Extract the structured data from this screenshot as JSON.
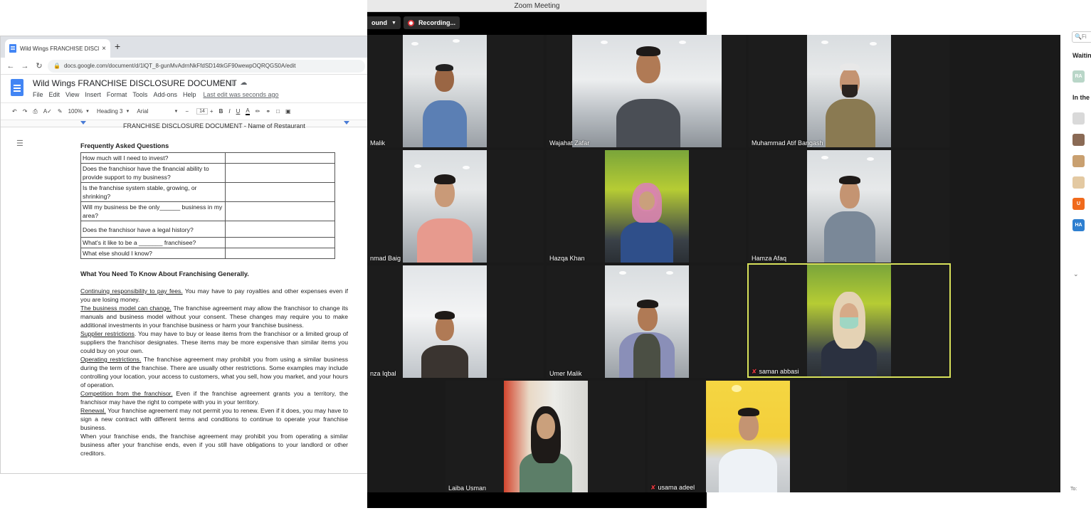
{
  "browser": {
    "tab_title": "Wild Wings FRANCHISE DISCLOSU",
    "tab_close": "×",
    "new_tab": "+",
    "url": "docs.google.com/document/d/1lQT_8-gunMvAdrnNkFfdSD14tkGF90wewpOQRQGS0A/edit"
  },
  "docs": {
    "title": "Wild Wings FRANCHISE DISCLOSURE DOCUMENT",
    "menu": [
      "File",
      "Edit",
      "View",
      "Insert",
      "Format",
      "Tools",
      "Add-ons",
      "Help"
    ],
    "last_edit": "Last edit was seconds ago",
    "toolbar": {
      "zoom": "100%",
      "style": "Heading 3",
      "font": "Arial",
      "font_minus": "−",
      "font_size": "14",
      "font_plus": "+",
      "bold": "B",
      "italic": "I",
      "underline": "U",
      "text_color": "A"
    },
    "page_header": "FRANCHISE DISCLOSURE DOCUMENT - Name of Restaurant",
    "faq_heading": "Frequently Asked Questions",
    "faq_rows": [
      "How much will I need to invest?",
      "Does the franchisor have the financial ability to provide support to my business?",
      "Is the franchise system stable, growing, or shrinking?",
      "Will my business be the only______ business in my area?",
      "Does the franchisor have a legal history?",
      "What's it like to be a _______ franchisee?",
      "What else should I know?"
    ],
    "section_heading": "What You Need To Know About Franchising Generally.",
    "paragraphs": [
      {
        "lead": "Continuing responsibility to pay fees.",
        "text": " You may have to pay royalties and other expenses even if you are losing money."
      },
      {
        "lead": "The business model can change.",
        "text": " The franchise agreement may allow the franchisor to change its manuals and business model without your consent. These changes may require you to make additional investments in your franchise business or harm your franchise business."
      },
      {
        "lead": "Supplier restrictions",
        "text": ". You may have to buy or lease items from the franchisor or a limited group of suppliers the franchisor designates. These items may be more expensive than similar items you could buy on your own."
      },
      {
        "lead": "Operating restrictions.",
        "text": " The franchise agreement may prohibit you from using a similar business during the term of the franchise. There are usually other restrictions. Some examples may include controlling your location, your access to customers, what you sell, how you market, and your hours of operation."
      },
      {
        "lead": "Competition from the franchisor.",
        "text": " Even if the franchise agreement grants you a territory, the franchisor may have the right to compete with you in your territory."
      },
      {
        "lead": "Renewal.",
        "text": " Your franchise agreement may not permit you to renew. Even if it does, you may have to sign a new contract with different terms and conditions to continue to operate your franchise business."
      },
      {
        "lead": "",
        "text": "When your franchise ends, the franchise agreement may prohibit you from operating a similar business after your franchise ends, even if you still have obligations to your landlord or other creditors."
      }
    ]
  },
  "zoom": {
    "window_title": "Zoom Meeting",
    "sound_btn": "ound",
    "recording_btn": "Recording...",
    "participants": [
      {
        "name": "Malik",
        "muted": false
      },
      {
        "name": "Wajahat Zafar",
        "muted": false
      },
      {
        "name": "Muhammad Atif Bangash",
        "muted": false
      },
      {
        "name": "nmad Baig",
        "muted": false
      },
      {
        "name": "Hazqa Khan",
        "muted": false
      },
      {
        "name": "Hamza Afaq",
        "muted": false
      },
      {
        "name": "nza Iqbal",
        "muted": false
      },
      {
        "name": "Umer Malik",
        "muted": false
      },
      {
        "name": "saman abbasi",
        "muted": true
      },
      {
        "name": "Laiba Usman",
        "muted": false
      },
      {
        "name": "usama adeel",
        "muted": true
      }
    ],
    "mic_icon": "✘",
    "panel": {
      "search": "Fi",
      "waiting": "Waitin",
      "in_the": "In the",
      "avatars": [
        "RA",
        "",
        "",
        "",
        "U",
        "HA"
      ],
      "avatar_colors": [
        "#b9d6c8",
        "#d9d9d9",
        "#8a6a55",
        "#c9a070",
        "#f06a1c",
        "#2e7fd0"
      ],
      "to_label": "To:"
    }
  }
}
